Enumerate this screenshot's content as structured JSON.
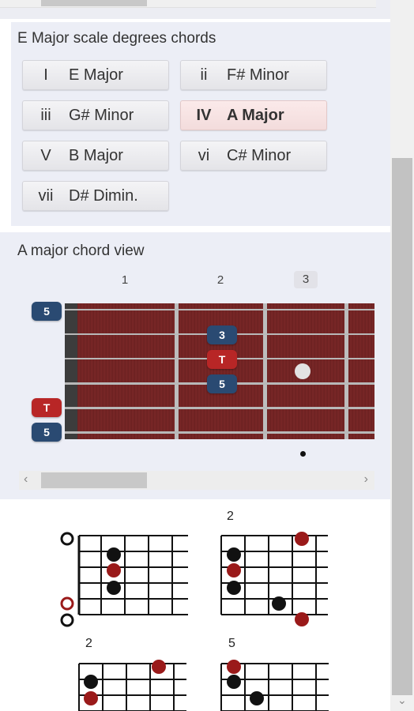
{
  "chords_panel": {
    "title": "E Major scale degrees chords",
    "buttons": [
      {
        "degree": "I",
        "name": "E Major",
        "active": false
      },
      {
        "degree": "ii",
        "name": "F# Minor",
        "active": false
      },
      {
        "degree": "iii",
        "name": "G# Minor",
        "active": false
      },
      {
        "degree": "IV",
        "name": "A Major",
        "active": true
      },
      {
        "degree": "V",
        "name": "B Major",
        "active": false
      },
      {
        "degree": "vi",
        "name": "C# Minor",
        "active": false
      },
      {
        "degree": "vii",
        "name": "D# Dimin.",
        "active": false
      }
    ]
  },
  "chord_view": {
    "title": "A major chord view",
    "fret_numbers": [
      "1",
      "2",
      "3"
    ],
    "open_notes": [
      {
        "label": "5",
        "color": "blue",
        "string": 1
      },
      {
        "label": "T",
        "color": "red",
        "string": 5
      },
      {
        "label": "5",
        "color": "blue",
        "string": 6
      }
    ],
    "fretted_notes": [
      {
        "label": "3",
        "color": "blue",
        "fret": 2,
        "string": 2
      },
      {
        "label": "T",
        "color": "red",
        "fret": 2,
        "string": 3
      },
      {
        "label": "5",
        "color": "blue",
        "fret": 2,
        "string": 4
      }
    ],
    "scroll": {
      "left_arrow": "‹",
      "right_arrow": "›"
    }
  },
  "diagrams": [
    {
      "fret_label": "",
      "open": [
        {
          "string": 1,
          "type": "open"
        },
        {
          "string": 5,
          "type": "root-open"
        },
        {
          "string": 6,
          "type": "open"
        }
      ],
      "dots": [
        {
          "string": 2,
          "fret": 2,
          "color": "black"
        },
        {
          "string": 3,
          "fret": 2,
          "color": "red"
        },
        {
          "string": 4,
          "fret": 2,
          "color": "black"
        }
      ]
    },
    {
      "fret_label": "2",
      "open": [],
      "dots": [
        {
          "string": 1,
          "fret": 1,
          "color": "red"
        },
        {
          "string": 2,
          "fret": 1,
          "color": "black"
        },
        {
          "string": 3,
          "fret": 1,
          "color": "red"
        },
        {
          "string": 4,
          "fret": 1,
          "color": "black"
        },
        {
          "string": 5,
          "fret": 3,
          "color": "black"
        },
        {
          "string": 6,
          "fret": 4,
          "color": "red"
        }
      ],
      "note": "dot on string1 at fret 4 column"
    },
    {
      "fret_label": "2",
      "open": [],
      "dots": [
        {
          "string": 1,
          "fret": 4,
          "color": "red"
        },
        {
          "string": 2,
          "fret": 1,
          "color": "black"
        },
        {
          "string": 3,
          "fret": 1,
          "color": "red"
        }
      ]
    },
    {
      "fret_label": "5",
      "open": [],
      "dots": [
        {
          "string": 1,
          "fret": 1,
          "color": "red"
        },
        {
          "string": 2,
          "fret": 1,
          "color": "black"
        },
        {
          "string": 3,
          "fret": 2,
          "color": "black"
        }
      ]
    }
  ],
  "colors": {
    "accent_red": "#b82626",
    "note_blue": "#2a4a72",
    "diagram_red": "#9a1a1a",
    "fretboard": "#6e2222"
  }
}
